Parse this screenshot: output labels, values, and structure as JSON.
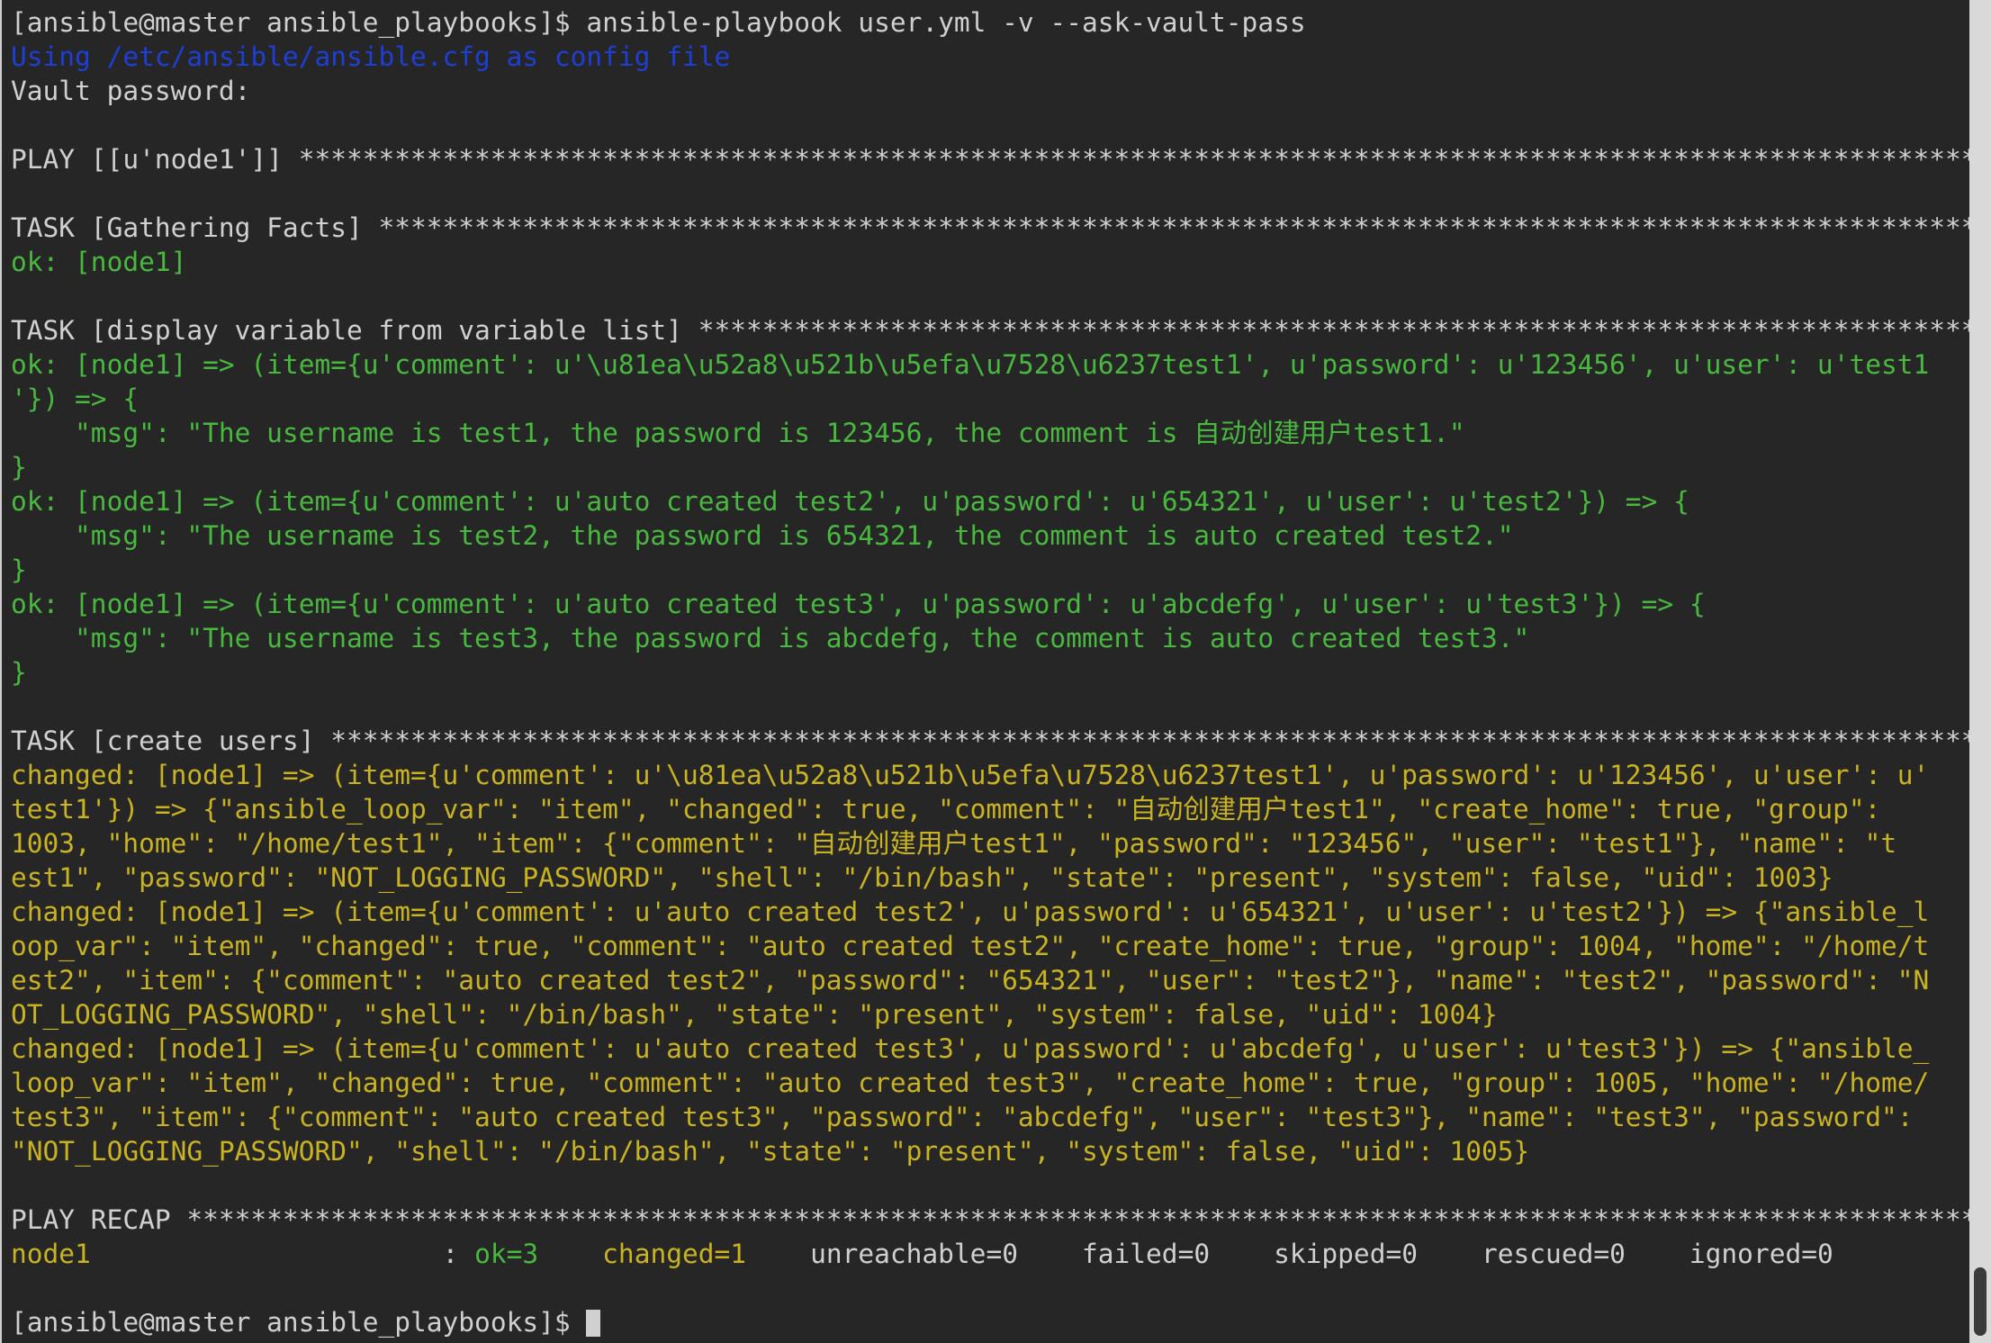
{
  "colors": {
    "background": "#262626",
    "default_text": "#d0d0d0",
    "info_blue": "#1e3fd6",
    "ok_green": "#49b83f",
    "changed_yellow": "#c9b320"
  },
  "terminal": {
    "lines": [
      [
        {
          "c": "w",
          "t": "[ansible@master ansible_playbooks]$ ansible-playbook user.yml -v --ask-vault-pass"
        }
      ],
      [
        {
          "c": "b",
          "t": "Using /etc/ansible/ansible.cfg as config file"
        }
      ],
      [
        {
          "c": "w",
          "t": "Vault password:"
        }
      ],
      [
        {
          "c": "w",
          "t": ""
        }
      ],
      [
        {
          "c": "w",
          "t": "PLAY [[u'node1']] *********************************************************************************************************"
        }
      ],
      [
        {
          "c": "w",
          "t": ""
        }
      ],
      [
        {
          "c": "w",
          "t": "TASK [Gathering Facts] ****************************************************************************************************"
        }
      ],
      [
        {
          "c": "g",
          "t": "ok: [node1]"
        }
      ],
      [
        {
          "c": "w",
          "t": ""
        }
      ],
      [
        {
          "c": "w",
          "t": "TASK [display variable from variable list] ********************************************************************************"
        }
      ],
      [
        {
          "c": "g",
          "t": "ok: [node1] => (item={u'comment': u'\\u81ea\\u52a8\\u521b\\u5efa\\u7528\\u6237test1', u'password': u'123456', u'user': u'test1"
        }
      ],
      [
        {
          "c": "g",
          "t": "'}) => {"
        }
      ],
      [
        {
          "c": "g",
          "t": "    \"msg\": \"The username is test1, the password is 123456, the comment is 自动创建用户test1.\""
        }
      ],
      [
        {
          "c": "g",
          "t": "}"
        }
      ],
      [
        {
          "c": "g",
          "t": "ok: [node1] => (item={u'comment': u'auto created test2', u'password': u'654321', u'user': u'test2'}) => {"
        }
      ],
      [
        {
          "c": "g",
          "t": "    \"msg\": \"The username is test2, the password is 654321, the comment is auto created test2.\""
        }
      ],
      [
        {
          "c": "g",
          "t": "}"
        }
      ],
      [
        {
          "c": "g",
          "t": "ok: [node1] => (item={u'comment': u'auto created test3', u'password': u'abcdefg', u'user': u'test3'}) => {"
        }
      ],
      [
        {
          "c": "g",
          "t": "    \"msg\": \"The username is test3, the password is abcdefg, the comment is auto created test3.\""
        }
      ],
      [
        {
          "c": "g",
          "t": "}"
        }
      ],
      [
        {
          "c": "w",
          "t": ""
        }
      ],
      [
        {
          "c": "w",
          "t": "TASK [create users] *******************************************************************************************************"
        }
      ],
      [
        {
          "c": "y",
          "t": "changed: [node1] => (item={u'comment': u'\\u81ea\\u52a8\\u521b\\u5efa\\u7528\\u6237test1', u'password': u'123456', u'user': u'"
        }
      ],
      [
        {
          "c": "y",
          "t": "test1'}) => {\"ansible_loop_var\": \"item\", \"changed\": true, \"comment\": \"自动创建用户test1\", \"create_home\": true, \"group\":"
        }
      ],
      [
        {
          "c": "y",
          "t": "1003, \"home\": \"/home/test1\", \"item\": {\"comment\": \"自动创建用户test1\", \"password\": \"123456\", \"user\": \"test1\"}, \"name\": \"t"
        }
      ],
      [
        {
          "c": "y",
          "t": "est1\", \"password\": \"NOT_LOGGING_PASSWORD\", \"shell\": \"/bin/bash\", \"state\": \"present\", \"system\": false, \"uid\": 1003}"
        }
      ],
      [
        {
          "c": "y",
          "t": "changed: [node1] => (item={u'comment': u'auto created test2', u'password': u'654321', u'user': u'test2'}) => {\"ansible_l"
        }
      ],
      [
        {
          "c": "y",
          "t": "oop_var\": \"item\", \"changed\": true, \"comment\": \"auto created test2\", \"create_home\": true, \"group\": 1004, \"home\": \"/home/t"
        }
      ],
      [
        {
          "c": "y",
          "t": "est2\", \"item\": {\"comment\": \"auto created test2\", \"password\": \"654321\", \"user\": \"test2\"}, \"name\": \"test2\", \"password\": \"N"
        }
      ],
      [
        {
          "c": "y",
          "t": "OT_LOGGING_PASSWORD\", \"shell\": \"/bin/bash\", \"state\": \"present\", \"system\": false, \"uid\": 1004}"
        }
      ],
      [
        {
          "c": "y",
          "t": "changed: [node1] => (item={u'comment': u'auto created test3', u'password': u'abcdefg', u'user': u'test3'}) => {\"ansible_"
        }
      ],
      [
        {
          "c": "y",
          "t": "loop_var\": \"item\", \"changed\": true, \"comment\": \"auto created test3\", \"create_home\": true, \"group\": 1005, \"home\": \"/home/"
        }
      ],
      [
        {
          "c": "y",
          "t": "test3\", \"item\": {\"comment\": \"auto created test3\", \"password\": \"abcdefg\", \"user\": \"test3\"}, \"name\": \"test3\", \"password\":"
        }
      ],
      [
        {
          "c": "y",
          "t": "\"NOT_LOGGING_PASSWORD\", \"shell\": \"/bin/bash\", \"state\": \"present\", \"system\": false, \"uid\": 1005}"
        }
      ],
      [
        {
          "c": "w",
          "t": ""
        }
      ],
      [
        {
          "c": "w",
          "t": "PLAY RECAP ****************************************************************************************************************"
        }
      ],
      [
        {
          "c": "y",
          "t": "node1"
        },
        {
          "c": "w",
          "t": "                      : "
        },
        {
          "c": "g",
          "t": "ok=3"
        },
        {
          "c": "w",
          "t": "    "
        },
        {
          "c": "y",
          "t": "changed=1"
        },
        {
          "c": "w",
          "t": "    unreachable=0    failed=0    skipped=0    rescued=0    ignored=0"
        }
      ],
      [
        {
          "c": "w",
          "t": ""
        }
      ],
      [
        {
          "c": "w",
          "t": "[ansible@master ansible_playbooks]$ "
        }
      ]
    ]
  }
}
